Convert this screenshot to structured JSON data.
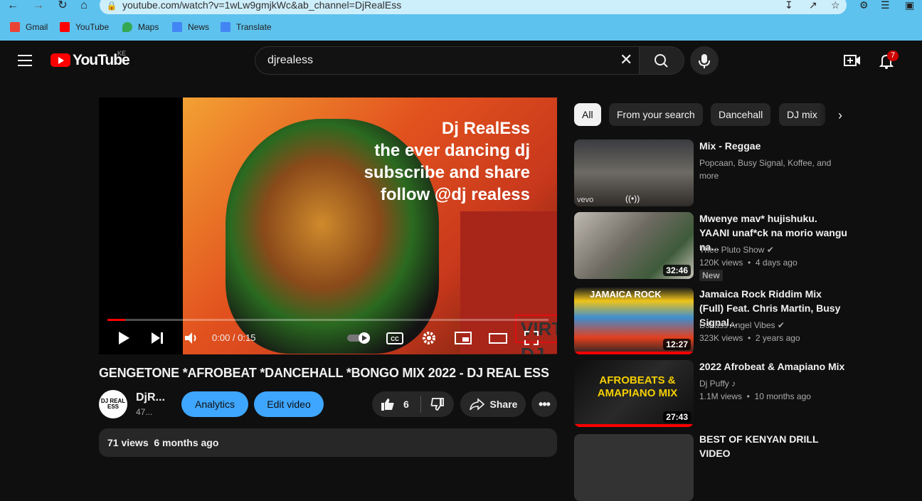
{
  "browser": {
    "url": "youtube.com/watch?v=1wLw9gmjkWc&ab_channel=DjRealEss",
    "bookmarks": [
      "Gmail",
      "YouTube",
      "Maps",
      "News",
      "Translate"
    ]
  },
  "header": {
    "logo_text": "YouTube",
    "country": "KE",
    "search_value": "djrealess",
    "notification_count": "7"
  },
  "player": {
    "overlay_lines": [
      "Dj RealEss",
      "the ever dancing dj",
      "subscribe and share",
      "follow @dj realess"
    ],
    "watermark": "VIRTUAL DJ",
    "time": "0:00 / 0:15",
    "progress_fraction": 0.04
  },
  "video": {
    "title": "GENGETONE *AFROBEAT *DANCEHALL *BONGO MIX 2022 - DJ REAL ESS",
    "channel_name": "DjR...",
    "channel_subs": "47...",
    "avatar_text": "DJ REAL ESS",
    "analytics_label": "Analytics",
    "edit_label": "Edit video",
    "likes": "6",
    "share_label": "Share",
    "description_summary": "71 views  6 months ago"
  },
  "chips": [
    "All",
    "From your search",
    "Dancehall",
    "DJ mix"
  ],
  "recommendations": [
    {
      "title": "Mix - Reggae",
      "meta1": "Popcaan, Busy Signal, Koffee, and",
      "meta2": "more",
      "duration": "",
      "new": false
    },
    {
      "title": "Mwenye mav* hujishuku. YAANI unaf*ck na morio wangu na...",
      "meta1": "Thee Pluto Show",
      "meta2": "120K views  •  4 days ago",
      "duration": "32:46",
      "new": true,
      "new_label": "New"
    },
    {
      "title": "Jamaica Rock Riddim Mix (Full) Feat. Chris Martin, Busy Signal...",
      "meta1": "DJLass Angel Vibes",
      "meta2": "323K views  •  2 years ago",
      "duration": "12:27",
      "new": false
    },
    {
      "title": "2022 Afrobeat & Amapiano Mix",
      "meta1": "Dj Puffy",
      "meta2": "1.1M views  •  10 months ago",
      "duration": "27:43",
      "new": false
    },
    {
      "title": "BEST OF KENYAN DRILL VIDEO",
      "meta1": "",
      "meta2": "",
      "duration": "",
      "new": false
    }
  ],
  "thumb_text": {
    "vevo": "vevo",
    "jamaica": "JAMAICA ROCK",
    "afro": "AFROBEATS & AMAPIANO MIX"
  },
  "colors": {
    "accent": "#ff0000",
    "blue_button": "#3ea6ff",
    "browser_bar": "#5ec2ee"
  }
}
